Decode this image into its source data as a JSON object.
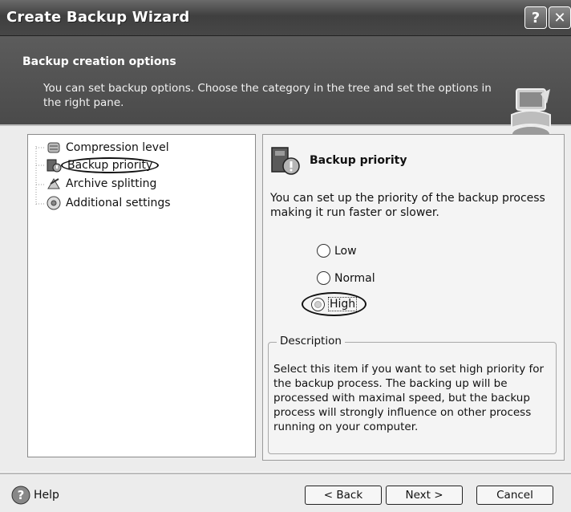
{
  "window": {
    "title": "Create Backup Wizard"
  },
  "titlebar": {
    "help_glyph": "?",
    "close_glyph": "✕"
  },
  "header": {
    "title": "Backup creation options",
    "description": "You can set backup options. Choose the category in the tree and set the options in the right pane."
  },
  "tree": {
    "items": [
      {
        "label": "Compression level",
        "icon": "compression-icon"
      },
      {
        "label": "Backup priority",
        "icon": "priority-icon",
        "selected": true
      },
      {
        "label": "Archive splitting",
        "icon": "splitting-icon"
      },
      {
        "label": "Additional settings",
        "icon": "settings-icon"
      }
    ]
  },
  "options": {
    "title": "Backup priority",
    "description": "You can set up the priority of the backup process making it run faster or slower.",
    "radios": [
      {
        "label": "Low",
        "checked": false
      },
      {
        "label": "Normal",
        "checked": false
      },
      {
        "label": "High",
        "checked": true
      }
    ],
    "group_legend": "Description",
    "group_text": "Select this item if you want to set high priority for the backup process. The backing up will be processed with maximal speed, but the backup process will strongly influence on other process running on your computer."
  },
  "footer": {
    "help": "Help",
    "back": "< Back",
    "next": "Next >",
    "cancel": "Cancel"
  }
}
